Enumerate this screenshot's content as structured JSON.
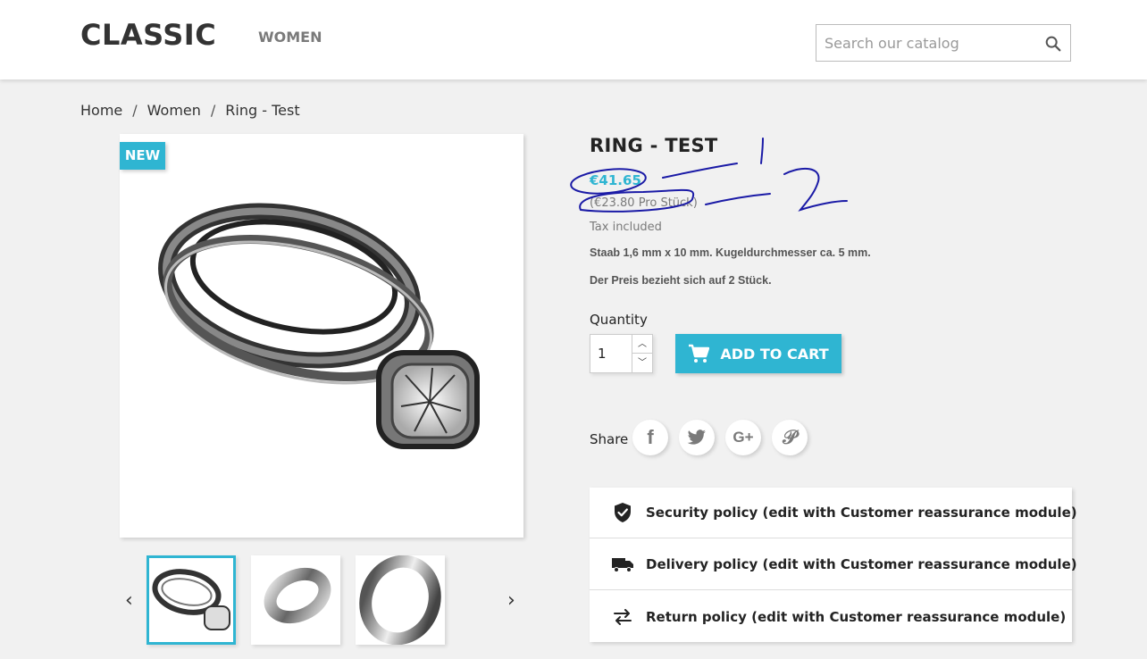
{
  "header": {
    "logo": "CLASSIC",
    "nav_women": "WOMEN",
    "search_placeholder": "Search our catalog"
  },
  "breadcrumb": [
    "Home",
    "Women",
    "Ring - Test"
  ],
  "badge": "NEW",
  "product": {
    "title": "RING - TEST",
    "price": "€41.65",
    "unit_price": "(€23.80 Pro Stück)",
    "tax": "Tax included",
    "desc1": "Staab 1,6 mm x 10 mm. Kugeldurchmesser ca. 5  mm.",
    "desc2": "Der Preis bezieht sich auf 2 Stück."
  },
  "quantity": {
    "label": "Quantity",
    "value": "1"
  },
  "cart": {
    "label": "ADD TO CART"
  },
  "share": {
    "label": "Share"
  },
  "reassurance": [
    "Security policy (edit with Customer reassurance module)",
    "Delivery policy (edit with Customer reassurance module)",
    "Return policy (edit with Customer reassurance module)"
  ],
  "colors": {
    "accent": "#2fb5d2",
    "annotation": "#1a1aa6"
  }
}
